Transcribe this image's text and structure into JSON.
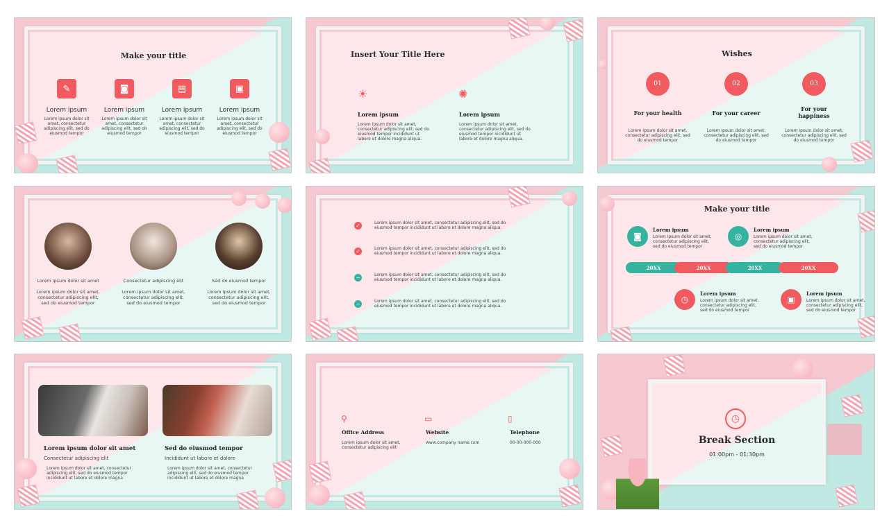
{
  "colors": {
    "coral": "#f15a5e",
    "teal": "#36b3a0"
  },
  "s1": {
    "title": "Make your title",
    "items": [
      {
        "icon": "pen-icon",
        "label": "Lorem ipsum",
        "text1": "Lorem ipsum dolor sit",
        "text2": "amet, consectetur",
        "text3": "adipiscing elit, sed do",
        "text4": "eiusmod tempor"
      },
      {
        "icon": "camera-icon",
        "label": "Lorem ipsum",
        "text1": "Lorem ipsum dolor sit",
        "text2": "amet, consectetur",
        "text3": "adipiscing elit, sed do",
        "text4": "eiusmod tempor"
      },
      {
        "icon": "clapper-icon",
        "label": "Lorem ipsum",
        "text1": "Lorem ipsum dolor sit",
        "text2": "amet, consectetur",
        "text3": "adipiscing elit, sed do",
        "text4": "eiusmod tempor"
      },
      {
        "icon": "photo-icon",
        "label": "Lorem ipsum",
        "text1": "Lorem ipsum dolor sit",
        "text2": "amet, consectetur",
        "text3": "adipiscing elit, sed do",
        "text4": "eiusmod tempor"
      }
    ]
  },
  "s2": {
    "title": "Insert Your Title Here",
    "items": [
      {
        "icon": "lightbulb-icon",
        "label": "Lorem ipsum",
        "text1": "Lorem ipsum dolor sit amet,",
        "text2": "consectetur adipiscing elit, sed do",
        "text3": "eiusmod tempor incididunt ut",
        "text4": "labore et dolore magna aliqua."
      },
      {
        "icon": "fireworks-icon",
        "label": "Lorem ipsum",
        "text1": "Lorem ipsum dolor sit amet,",
        "text2": "consectetur adipiscing elit, sed do",
        "text3": "eiusmod tempor incididunt ut",
        "text4": "labore et dolore magna aliqua."
      }
    ]
  },
  "s3": {
    "title": "Wishes",
    "items": [
      {
        "num": "01",
        "label": "For your health",
        "label2": "",
        "text1": "Lorem ipsum dolor sit amet,",
        "text2": "consectetur adipiscing elit, sed",
        "text3": "do eiusmod tempor"
      },
      {
        "num": "02",
        "label": "For your career",
        "label2": "",
        "text1": "Lorem ipsum dolor sit amet,",
        "text2": "consectetur adipiscing elit, sed",
        "text3": "do eiusmod tempor"
      },
      {
        "num": "03",
        "label": "For your",
        "label2": "happiness",
        "text1": "Lorem ipsum dolor sit amet,",
        "text2": "consectetur adipiscing elit, sed",
        "text3": "do eiusmod tempor"
      }
    ]
  },
  "s4": {
    "items": [
      {
        "caption": "Lorem ipsum dolor sit amet",
        "text1": "Lorem ipsum dolor sit amet,",
        "text2": "consectetur adipiscing elit,",
        "text3": "sed do eiusmod tempor"
      },
      {
        "caption": "Consectetur adipiscing elit",
        "text1": "Lorem ipsum dolor sit amet,",
        "text2": "consectetur adipiscing elit,",
        "text3": "sed do eiusmod tempor"
      },
      {
        "caption": "Sed do eiusmod tempor",
        "text1": "Lorem ipsum dolor sit amet,",
        "text2": "consectetur adipiscing elit,",
        "text3": "sed do eiusmod tempor"
      }
    ]
  },
  "s5": {
    "items": [
      {
        "mark": "✓",
        "line1": "Lorem ipsum dolor sit amet, consectetur adipiscing elit, sed do",
        "line2": "eiusmod tempor incididunt ut labore et dolore magna aliqua."
      },
      {
        "mark": "✓",
        "line1": "Lorem ipsum dolor sit amet, consectetur adipiscing elit, sed do",
        "line2": "eiusmod tempor incididunt ut labore et dolore magna aliqua."
      },
      {
        "mark": "−",
        "line1": "Lorem ipsum dolor sit amet, consectetur adipiscing elit, sed do",
        "line2": "eiusmod tempor incididunt ut labore et dolore magna aliqua."
      },
      {
        "mark": "−",
        "line1": "Lorem ipsum dolor sit amet, consectetur adipiscing elit, sed do",
        "line2": "eiusmod tempor incididunt ut labore et dolore magna aliqua."
      }
    ]
  },
  "s6": {
    "title": "Make your title",
    "pills": [
      "20XX",
      "20XX",
      "20XX",
      "20XX"
    ],
    "items": [
      {
        "label": "Lorem ipsum",
        "text1": "Lorem ipsum dolor sit amet,",
        "text2": "consectetur adipiscing elit,",
        "text3": "sed do eiusmod tempor"
      },
      {
        "label": "Lorem ipsum",
        "text1": "Lorem ipsum dolor sit amet,",
        "text2": "consectetur adipiscing elit,",
        "text3": "sed do eiusmod tempor"
      },
      {
        "label": "Lorem ipsum",
        "text1": "Lorem ipsum dolor sit amet,",
        "text2": "consectetur adipiscing elit,",
        "text3": "sed do eiusmod tempor"
      },
      {
        "label": "Lorem ipsum",
        "text1": "Lorem ipsum dolor sit amet,",
        "text2": "consectetur adipiscing elit,",
        "text3": "sed do eiusmod tempor"
      }
    ]
  },
  "s7": {
    "items": [
      {
        "heading": "Lorem ipsum dolor sit amet",
        "sub": "Consectetur adipiscing elit",
        "text1": "Lorem ipsum dolor sit amet, consectetur",
        "text2": "adipiscing elit, sed do eiusmod tempor",
        "text3": "incididunt ut labore et dolore magna"
      },
      {
        "heading": "Sed do eiusmod tempor",
        "sub": "Incididunt ut labore et dolore",
        "text1": "Lorem ipsum dolor sit amet, consectetur",
        "text2": "adipiscing elit, sed do eiusmod tempor",
        "text3": "incididunt ut labore et dolore magna"
      }
    ]
  },
  "s8": {
    "items": [
      {
        "icon": "map-pin-icon",
        "label": "Office Address",
        "text1": "Lorem ipsum dolor sit amet,",
        "text2": "consectetur adipiscing elit"
      },
      {
        "icon": "laptop-icon",
        "label": "Website",
        "text1": "www.company name.com",
        "text2": ""
      },
      {
        "icon": "phone-icon",
        "label": "Telephone",
        "text1": "00-00-000-000",
        "text2": ""
      }
    ]
  },
  "s9": {
    "title": "Break Section",
    "time": "01:00pm - 01:30pm"
  }
}
